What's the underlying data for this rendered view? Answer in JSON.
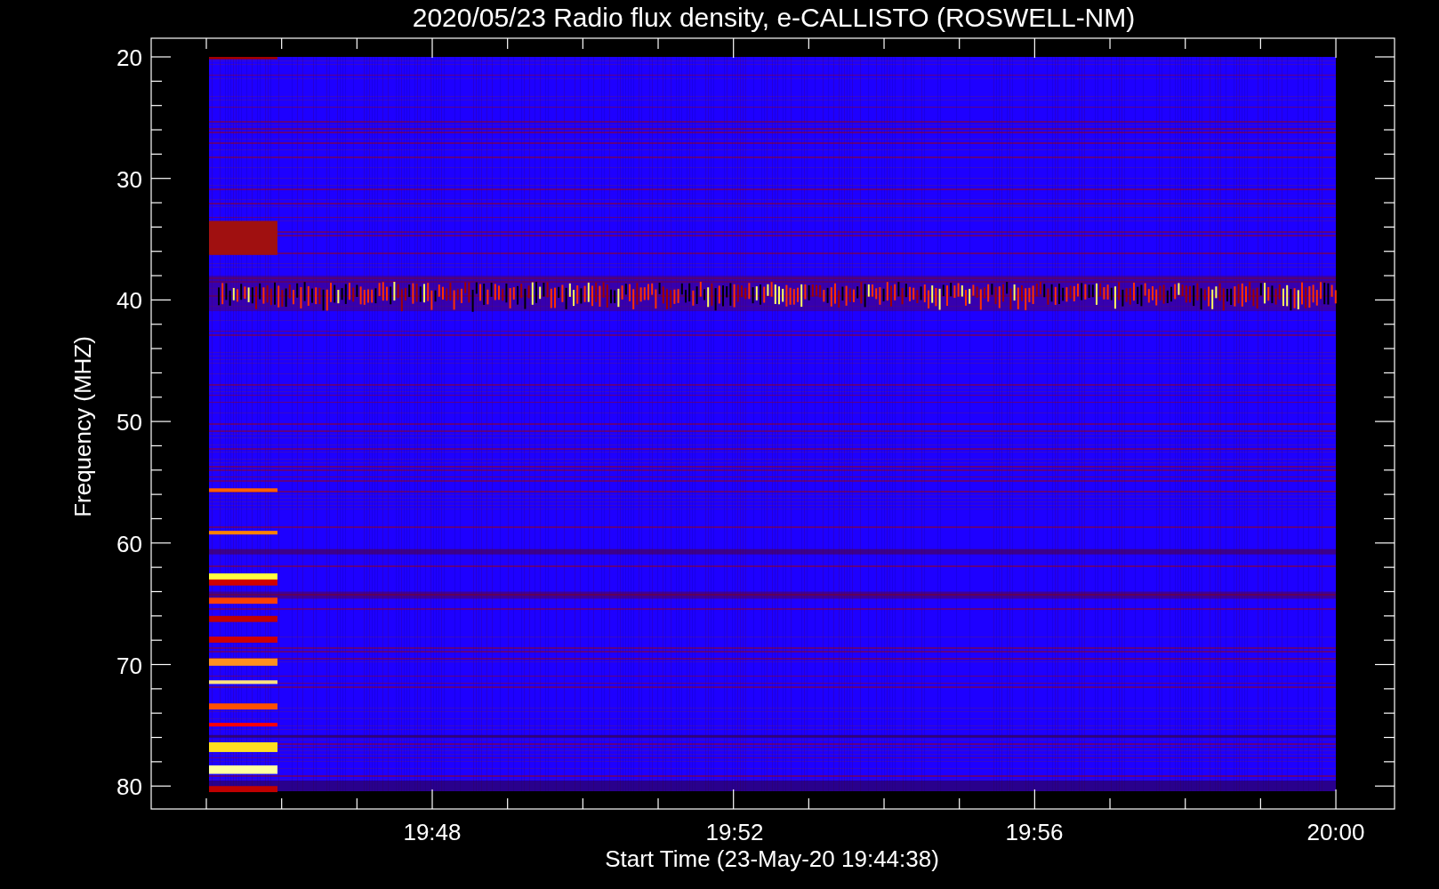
{
  "plot": {
    "title": "2020/05/23  Radio flux density, e-CALLISTO (ROSWELL-NM)",
    "ylabel": "Frequency (MHZ)",
    "xlabel": "Start Time (23-May-20 19:44:38)",
    "yticks": [
      "20",
      "30",
      "40",
      "50",
      "60",
      "70",
      "80"
    ],
    "xticks": [
      "19:48",
      "19:52",
      "19:56",
      "20:00"
    ]
  }
}
